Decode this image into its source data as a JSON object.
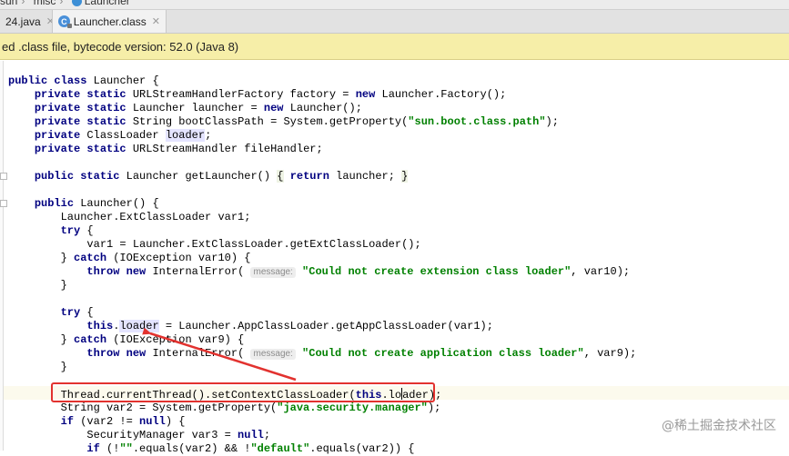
{
  "breadcrumb": {
    "items": [
      "sun",
      "misc",
      "Launcher"
    ]
  },
  "tabs": [
    {
      "label": "24.java",
      "active": false
    },
    {
      "label": "Launcher.class",
      "active": true
    }
  ],
  "banner": {
    "text": "ed .class file, bytecode version: 52.0 (Java 8)"
  },
  "code": {
    "lines": [
      [
        [
          "kw",
          "public "
        ],
        [
          "kw",
          "class "
        ],
        [
          "t",
          "Launcher {"
        ]
      ],
      [
        [
          "t",
          "    "
        ],
        [
          "kw",
          "private "
        ],
        [
          "kw",
          "static "
        ],
        [
          "t",
          "URLStreamHandlerFactory factory = "
        ],
        [
          "kw",
          "new "
        ],
        [
          "t",
          "Launcher.Factory();"
        ]
      ],
      [
        [
          "t",
          "    "
        ],
        [
          "kw",
          "private "
        ],
        [
          "kw",
          "static "
        ],
        [
          "t",
          "Launcher launcher = "
        ],
        [
          "kw",
          "new "
        ],
        [
          "t",
          "Launcher();"
        ]
      ],
      [
        [
          "t",
          "    "
        ],
        [
          "kw",
          "private "
        ],
        [
          "kw",
          "static "
        ],
        [
          "t",
          "String bootClassPath = System.getProperty("
        ],
        [
          "str",
          "\"sun.boot.class.path\""
        ],
        [
          "t",
          ");"
        ]
      ],
      [
        [
          "t",
          "    "
        ],
        [
          "kw",
          "private "
        ],
        [
          "t",
          "ClassLoader "
        ],
        [
          "hl",
          "loader"
        ],
        [
          "t",
          ";"
        ]
      ],
      [
        [
          "t",
          "    "
        ],
        [
          "kw",
          "private "
        ],
        [
          "kw",
          "static "
        ],
        [
          "t",
          "URLStreamHandler fileHandler;"
        ]
      ],
      [],
      [
        [
          "t",
          "    "
        ],
        [
          "kw",
          "public "
        ],
        [
          "kw",
          "static "
        ],
        [
          "t",
          "Launcher getLauncher() "
        ],
        [
          "brace",
          "{"
        ],
        [
          "t",
          " "
        ],
        [
          "kw",
          "return "
        ],
        [
          "t",
          "launcher; "
        ],
        [
          "brace",
          "}"
        ]
      ],
      [],
      [
        [
          "t",
          "    "
        ],
        [
          "kw",
          "public "
        ],
        [
          "t",
          "Launcher() {"
        ]
      ],
      [
        [
          "t",
          "        Launcher.ExtClassLoader var1;"
        ]
      ],
      [
        [
          "t",
          "        "
        ],
        [
          "kw",
          "try "
        ],
        [
          "t",
          "{"
        ]
      ],
      [
        [
          "t",
          "            var1 = Launcher.ExtClassLoader.getExtClassLoader();"
        ]
      ],
      [
        [
          "t",
          "        } "
        ],
        [
          "kw",
          "catch "
        ],
        [
          "t",
          "(IOException var10) {"
        ]
      ],
      [
        [
          "t",
          "            "
        ],
        [
          "kw",
          "throw "
        ],
        [
          "kw",
          "new "
        ],
        [
          "t",
          "InternalError( "
        ],
        [
          "hint",
          "message:"
        ],
        [
          "t",
          " "
        ],
        [
          "str",
          "\"Could not create extension class loader\""
        ],
        [
          "t",
          ", var10);"
        ]
      ],
      [
        [
          "t",
          "        }"
        ]
      ],
      [],
      [
        [
          "t",
          "        "
        ],
        [
          "kw",
          "try "
        ],
        [
          "t",
          "{"
        ]
      ],
      [
        [
          "t",
          "            "
        ],
        [
          "kw",
          "this"
        ],
        [
          "t",
          "."
        ],
        [
          "hl",
          "loader"
        ],
        [
          "t",
          " = Launcher.AppClassLoader.getAppClassLoader(var1);"
        ]
      ],
      [
        [
          "t",
          "        } "
        ],
        [
          "kw",
          "catch "
        ],
        [
          "t",
          "(IOException var9) {"
        ]
      ],
      [
        [
          "t",
          "            "
        ],
        [
          "kw",
          "throw "
        ],
        [
          "kw",
          "new "
        ],
        [
          "t",
          "InternalError( "
        ],
        [
          "hint",
          "message:"
        ],
        [
          "t",
          " "
        ],
        [
          "str",
          "\"Could not create application class loader\""
        ],
        [
          "t",
          ", var9);"
        ]
      ],
      [
        [
          "t",
          "        }"
        ]
      ],
      [],
      [
        [
          "t",
          "        Thread.currentThread().setContextClassLoader("
        ],
        [
          "kw",
          "this"
        ],
        [
          "t",
          ".lo"
        ],
        [
          "caret",
          ""
        ],
        [
          "t",
          "ader);"
        ]
      ],
      [
        [
          "t",
          "        String var2 = System.getProperty("
        ],
        [
          "str",
          "\"java.security.manager\""
        ],
        [
          "t",
          ");"
        ]
      ],
      [
        [
          "t",
          "        "
        ],
        [
          "kw",
          "if "
        ],
        [
          "t",
          "(var2 != "
        ],
        [
          "kw",
          "null"
        ],
        [
          "t",
          ") {"
        ]
      ],
      [
        [
          "t",
          "            SecurityManager var3 = "
        ],
        [
          "kw",
          "null"
        ],
        [
          "t",
          ";"
        ]
      ],
      [
        [
          "t",
          "            "
        ],
        [
          "kw",
          "if "
        ],
        [
          "t",
          "(!"
        ],
        [
          "str",
          "\"\""
        ],
        [
          "t",
          ".equals(var2) && !"
        ],
        [
          "str",
          "\"default\""
        ],
        [
          "t",
          ".equals(var2)) {"
        ]
      ]
    ]
  },
  "watermark": "@稀土掘金技术社区"
}
